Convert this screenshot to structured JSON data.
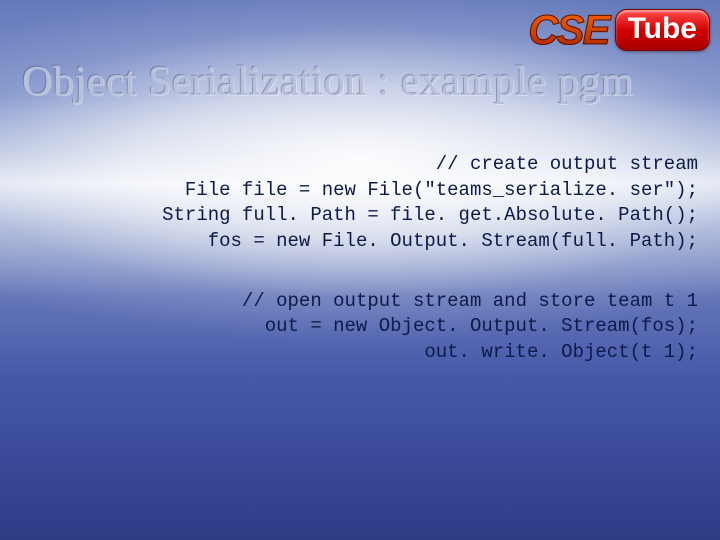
{
  "logo": {
    "cse": "CSE",
    "tube": "Tube"
  },
  "title": "Object Serialization : example pgm",
  "code": {
    "group1": {
      "l1": "// create output stream",
      "l2": "File file = new File(\"teams_serialize. ser\");",
      "l3": "String full. Path = file. get.Absolute. Path();",
      "l4": "fos = new File. Output. Stream(full. Path);"
    },
    "group2": {
      "l1": "// open output stream and store team t 1",
      "l2": "out = new Object. Output. Stream(fos);",
      "l3": "out. write. Object(t 1);"
    }
  }
}
